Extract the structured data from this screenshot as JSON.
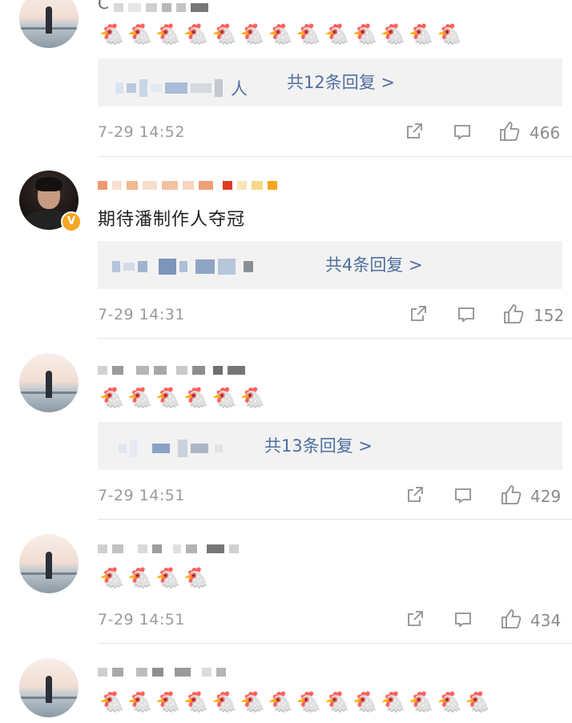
{
  "comments": [
    {
      "name_visible": "C",
      "emoji_text": "🐔🐔🐔🐔🐔🐔🐔🐔🐔🐔🐔🐔🐔",
      "reply_prefix": "人",
      "reply_link": "共12条回复 >",
      "time": "7-29 14:52",
      "likes": "466"
    },
    {
      "text": "期待潘制作人夺冠",
      "badge": "V",
      "reply_link": "共4条回复 >",
      "time": "7-29 14:31",
      "likes": "152"
    },
    {
      "emoji_text": "🐔🐔🐔🐔🐔🐔",
      "reply_link": "共13条回复 >",
      "time": "7-29 14:51",
      "likes": "429"
    },
    {
      "emoji_text": "🐔🐔🐔🐔",
      "time": "7-29 14:51",
      "likes": "434"
    },
    {
      "emoji_text": "🐔🐔🐔🐔🐔🐔🐔🐔🐔🐔🐔🐔🐔🐔"
    }
  ],
  "icons": {
    "share": "share-icon",
    "comment": "comment-icon",
    "like": "like-icon"
  },
  "colors": {
    "link": "#4e6fa0",
    "verified_badge": "#f5a623"
  }
}
